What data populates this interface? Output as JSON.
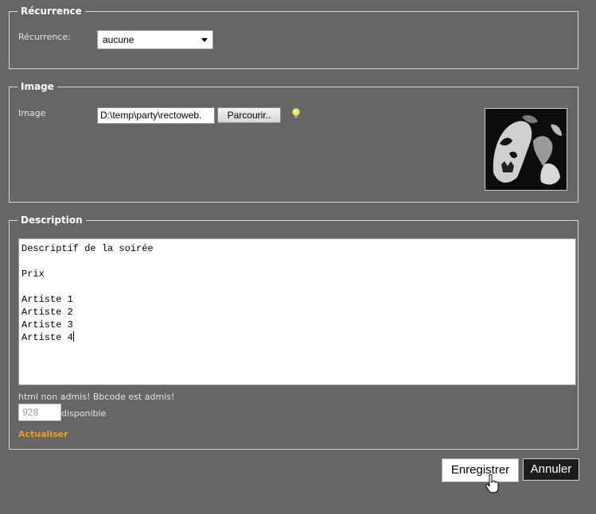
{
  "recurrence": {
    "legend": "Récurrence",
    "label": "Récurrence:",
    "selected": "aucune"
  },
  "image": {
    "legend": "Image",
    "label": "Image",
    "file_path": "D:\\temp\\party\\rectoweb.",
    "browse_label": "Parcourir..",
    "hint_icon": "lightbulb-icon",
    "thumbnail_icon": "image-thumbnail"
  },
  "description": {
    "legend": "Description",
    "text_lines": [
      "Descriptif de la soirée",
      "",
      "Prix",
      "",
      "Artiste 1",
      "Artiste 2",
      "Artiste 3",
      "Artiste 4"
    ],
    "note": "html non admis! Bbcode est admis!",
    "remaining": "928",
    "remaining_label": "disponible",
    "refresh_label": "Actualiser"
  },
  "actions": {
    "save_label": "Enregistrer",
    "cancel_label": "Annuler"
  },
  "colors": {
    "background": "#666666",
    "accent": "#f39a1e",
    "cancel_bg": "#1c1c1c"
  }
}
